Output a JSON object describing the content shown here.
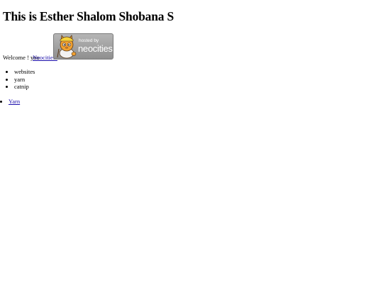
{
  "header": {
    "title": "This is Esther Shalom Shobana S"
  },
  "welcome": {
    "text": "Welcome ! you",
    "link_label": "Neocities!"
  },
  "badge": {
    "hosted_text": "hosted by",
    "brand_text": "neocities",
    "icon": "neocities-cat-icon"
  },
  "topics": {
    "items": [
      "websites",
      "yarn",
      "catnip"
    ]
  },
  "links": {
    "items": [
      "Yarn"
    ]
  },
  "colors": {
    "link": "#1a0dab",
    "badge_bg": "#a3a3a3"
  }
}
